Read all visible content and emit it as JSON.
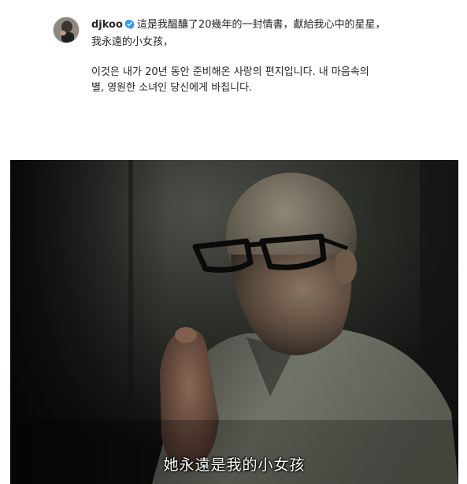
{
  "post": {
    "username": "djkoo",
    "caption_cn_line1": "這是我醞釀了20幾年的一封情書，獻給我心中的星星，",
    "caption_cn_line2": "我永遠的小女孩，",
    "caption_kr_line1": "이것은 내가 20년 동안 준비해온 사랑의 편지입니다. 내 마음속의",
    "caption_kr_line2": "별, 영원한 소녀인 당신에게 바칩니다."
  },
  "video": {
    "subtitle": "她永遠是我的小女孩"
  },
  "colors": {
    "verified_badge": "#3897f0",
    "text": "#262626"
  },
  "icons": {
    "verified": "verified-badge-icon"
  }
}
